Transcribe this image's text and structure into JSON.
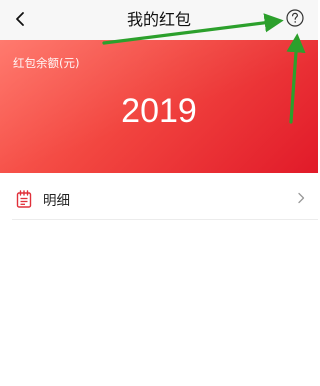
{
  "header": {
    "title": "我的红包",
    "back_icon": "back-arrow-icon",
    "help_icon": "question-circle-icon"
  },
  "balance": {
    "label": "红包余额(元)",
    "amount": "2019"
  },
  "detail": {
    "label": "明细",
    "icon": "notepad-icon",
    "chevron_icon": "chevron-right-icon"
  },
  "colors": {
    "card_start": "#ff6b5e",
    "card_end": "#e11a29",
    "icon_red": "#e0303a",
    "annotation_green": "#2ca02c"
  }
}
